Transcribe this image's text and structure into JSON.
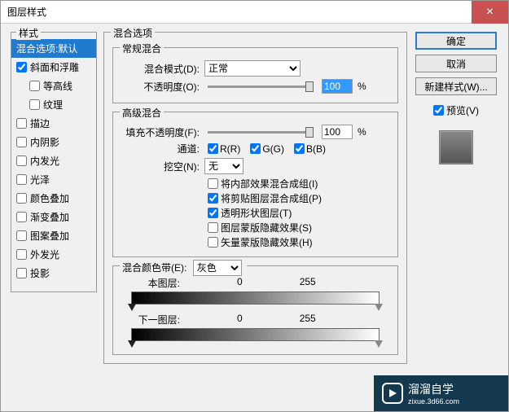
{
  "window": {
    "title": "图层样式"
  },
  "buttons": {
    "ok": "确定",
    "cancel": "取消",
    "new_style": "新建样式(W)...",
    "preview": "预览(V)",
    "close": "×"
  },
  "sidebar": {
    "legend": "样式",
    "items": [
      {
        "label": "混合选项:默认",
        "checked": null,
        "selected": true,
        "indent": false
      },
      {
        "label": "斜面和浮雕",
        "checked": true,
        "selected": false,
        "indent": false
      },
      {
        "label": "等高线",
        "checked": false,
        "selected": false,
        "indent": true
      },
      {
        "label": "纹理",
        "checked": false,
        "selected": false,
        "indent": true
      },
      {
        "label": "描边",
        "checked": false,
        "selected": false,
        "indent": false
      },
      {
        "label": "内阴影",
        "checked": false,
        "selected": false,
        "indent": false
      },
      {
        "label": "内发光",
        "checked": false,
        "selected": false,
        "indent": false
      },
      {
        "label": "光泽",
        "checked": false,
        "selected": false,
        "indent": false
      },
      {
        "label": "颜色叠加",
        "checked": false,
        "selected": false,
        "indent": false
      },
      {
        "label": "渐变叠加",
        "checked": false,
        "selected": false,
        "indent": false
      },
      {
        "label": "图案叠加",
        "checked": false,
        "selected": false,
        "indent": false
      },
      {
        "label": "外发光",
        "checked": false,
        "selected": false,
        "indent": false
      },
      {
        "label": "投影",
        "checked": false,
        "selected": false,
        "indent": false
      }
    ]
  },
  "main": {
    "legend": "混合选项",
    "general": {
      "legend": "常规混合",
      "blend_mode_label": "混合模式(D):",
      "blend_mode_value": "正常",
      "opacity_label": "不透明度(O):",
      "opacity_value": "100",
      "percent": "%"
    },
    "advanced": {
      "legend": "高级混合",
      "fill_label": "填充不透明度(F):",
      "fill_value": "100",
      "percent": "%",
      "channels_label": "通道:",
      "channels": {
        "r": "R(R)",
        "g": "G(G)",
        "b": "B(B)"
      },
      "knockout_label": "挖空(N):",
      "knockout_value": "无",
      "checks": {
        "interior": "将内部效果混合成组(I)",
        "clipped": "将剪贴图层混合成组(P)",
        "transparency": "透明形状图层(T)",
        "layer_mask": "图层蒙版隐藏效果(S)",
        "vector_mask": "矢量蒙版隐藏效果(H)"
      }
    },
    "blendif": {
      "label": "混合颜色带(E):",
      "value": "灰色",
      "this_layer": "本图层:",
      "underlying": "下一图层:",
      "min": "0",
      "max": "255"
    }
  },
  "watermark": {
    "text": "溜溜自学",
    "sub": "zixue.3d66.com"
  }
}
